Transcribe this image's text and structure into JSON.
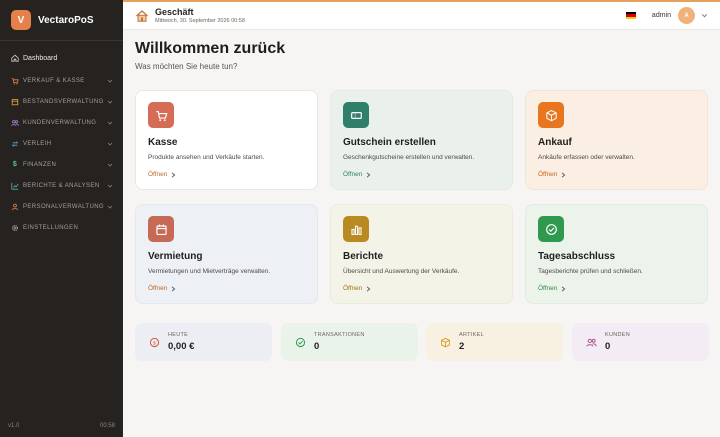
{
  "app": {
    "logo_letter": "V",
    "name": "VectaroPoS",
    "version": "v1.0",
    "clock": "00:58"
  },
  "sidebar": {
    "items": [
      {
        "label": "Dashboard",
        "icon": "home-icon"
      },
      {
        "label": "VERKAUF & KASSE",
        "icon": "cart-icon"
      },
      {
        "label": "BESTANDSVERWALTUNG",
        "icon": "box-icon"
      },
      {
        "label": "KUNDENVERWALTUNG",
        "icon": "users-icon"
      },
      {
        "label": "VERLEIH",
        "icon": "swap-icon"
      },
      {
        "label": "FINANZEN",
        "icon": "dollar-icon"
      },
      {
        "label": "BERICHTE & ANALYSEN",
        "icon": "chart-icon"
      },
      {
        "label": "PERSONALVERWALTUNG",
        "icon": "person-icon"
      },
      {
        "label": "EINSTELLUNGEN",
        "icon": "gear-icon"
      }
    ]
  },
  "header": {
    "title": "Geschäft",
    "subtitle": "Mittwoch, 30. September 2026 00:58",
    "user": "admin",
    "avatar_letter": "A",
    "language_flag": "de-flag-icon"
  },
  "main": {
    "title": "Willkommen zurück",
    "subtitle": "Was möchten Sie heute tun?",
    "cards": [
      {
        "title": "Kasse",
        "desc": "Produkte ansehen und Verkäufe starten.",
        "link": "Öffnen",
        "icon": "cart-icon"
      },
      {
        "title": "Gutschein erstellen",
        "desc": "Geschenkgutscheine erstellen und verwalten.",
        "link": "Öffnen",
        "icon": "ticket-icon"
      },
      {
        "title": "Ankauf",
        "desc": "Ankäufe erfassen oder verwalten.",
        "link": "Öffnen",
        "icon": "box-icon"
      },
      {
        "title": "Vermietung",
        "desc": "Vermietungen und Mietverträge verwalten.",
        "link": "Öffnen",
        "icon": "calendar-icon"
      },
      {
        "title": "Berichte",
        "desc": "Übersicht und Auswertung der Verkäufe.",
        "link": "Öffnen",
        "icon": "bar-chart-icon"
      },
      {
        "title": "Tagesabschluss",
        "desc": "Tagesberichte prüfen und schließen.",
        "link": "Öffnen",
        "icon": "check-circle-icon"
      }
    ],
    "stats": [
      {
        "label": "HEUTE",
        "value": "0,00 €",
        "icon": "coin-icon"
      },
      {
        "label": "TRANSAKTIONEN",
        "value": "0",
        "icon": "check-icon"
      },
      {
        "label": "ARTIKEL",
        "value": "2",
        "icon": "box-icon"
      },
      {
        "label": "KUNDEN",
        "value": "0",
        "icon": "users-icon"
      }
    ]
  },
  "colors": {
    "sidebar": "#26221f",
    "accent": "#e5804a",
    "link": "#b86a2e"
  }
}
